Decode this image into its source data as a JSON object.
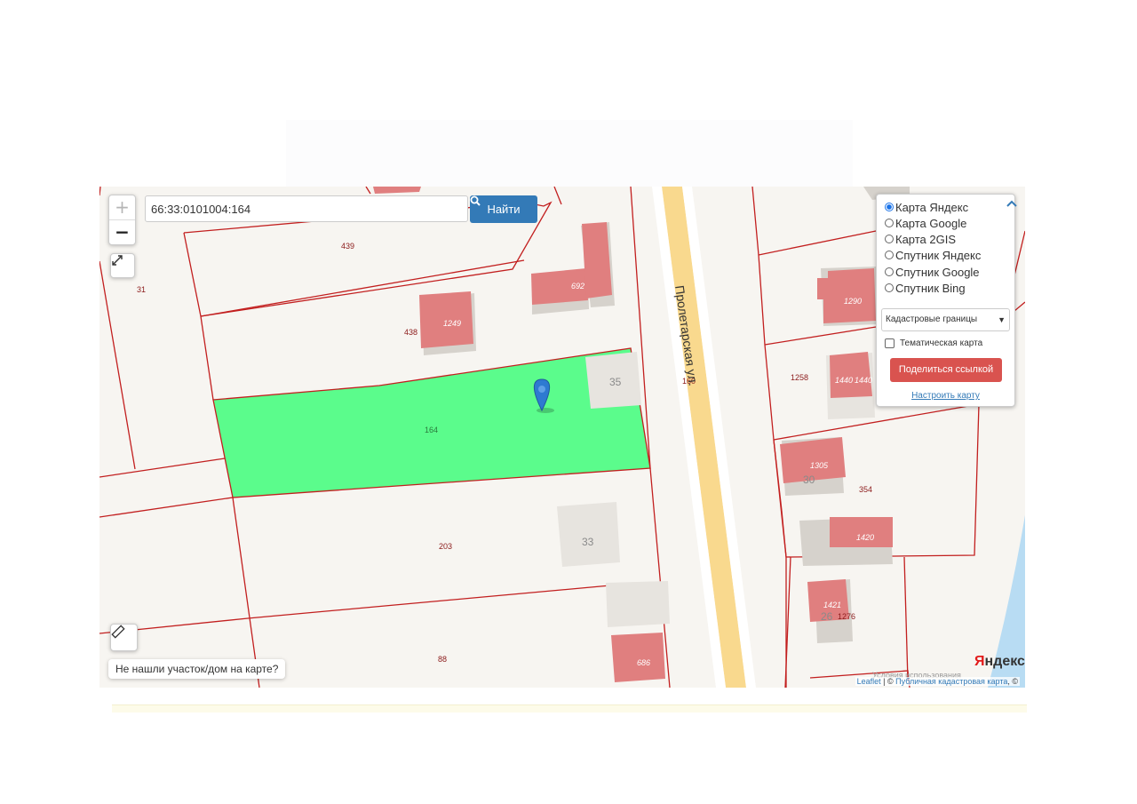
{
  "search": {
    "value": "66:33:0101004:164",
    "button_label": "Найти"
  },
  "zoom": {
    "in_label": "+",
    "out_label": "−"
  },
  "layers": {
    "options": [
      {
        "label": "Карта Яндекс",
        "selected": true
      },
      {
        "label": "Карта Google",
        "selected": false
      },
      {
        "label": "Карта 2GIS",
        "selected": false
      },
      {
        "label": "Спутник Яндекс",
        "selected": false
      },
      {
        "label": "Спутник Google",
        "selected": false
      },
      {
        "label": "Спутник Bing",
        "selected": false
      }
    ],
    "boundary_select": "Кадастровые границы",
    "thematic_label": "Тематическая карта",
    "share_label": "Поделиться ссылкой",
    "setup_label": "Настроить карту"
  },
  "not_found_label": "Не нашли участок/дом на карте?",
  "street_name": "Пролетарская ул.",
  "parcel_labels": {
    "p439": "439",
    "p31": "31",
    "p438": "438",
    "p164": "164",
    "p203": "203",
    "p88": "88",
    "p160": "160",
    "p1258": "1258",
    "p354": "354",
    "p1276": "1276"
  },
  "building_labels": {
    "b1249": "1249",
    "b692": "692",
    "b35": "35",
    "b33": "33",
    "b686": "686",
    "b1290": "1290",
    "b1440": "1440",
    "b1440b": "1440",
    "b1305": "1305",
    "b30": "30",
    "b1420": "1420",
    "b1421": "1421",
    "b26": "26"
  },
  "attribution": {
    "leaflet": "Leaflet",
    "separator": " | © ",
    "source": "Публичная кадастровая карта",
    "end": ", ©"
  },
  "yandex_logo": {
    "first": "Я",
    "rest": "ндекс"
  },
  "terms_text": "Условия использования",
  "colors": {
    "selected_parcel": "#5bfc8c",
    "boundary": "#c21f1f",
    "building": "#e07f7f",
    "road": "#f9d98e",
    "accent": "#337ab7",
    "share": "#d9534f"
  }
}
